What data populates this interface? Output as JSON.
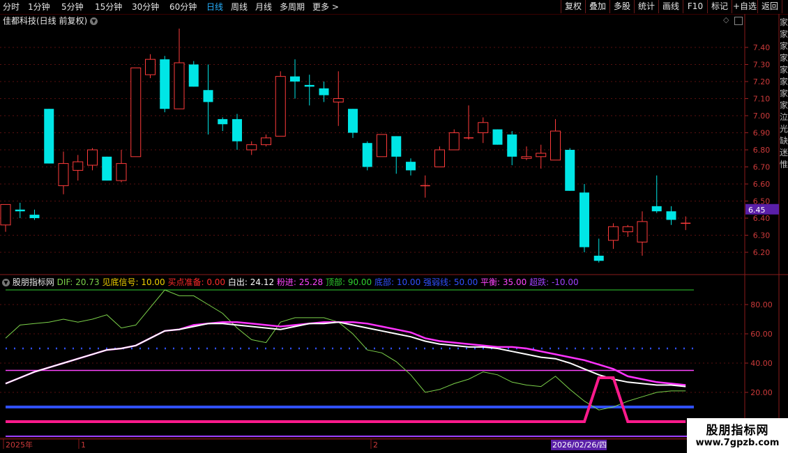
{
  "toolbar": {
    "periods": [
      "分时",
      "1分钟",
      "5分钟",
      "15分钟",
      "30分钟",
      "60分钟",
      "日线",
      "周线",
      "月线",
      "多周期",
      "更多 >"
    ],
    "active_period": "日线",
    "buttons": [
      "复权",
      "叠加",
      "多股",
      "统计",
      "画线",
      "F10",
      "标记",
      "+自选",
      "返回"
    ]
  },
  "main_chart": {
    "title": "佳都科技(日线 前复权)",
    "y_ticks": [
      "7.40",
      "7.30",
      "7.20",
      "7.10",
      "7.00",
      "6.90",
      "6.80",
      "6.70",
      "6.60",
      "6.50",
      "6.40",
      "6.30",
      "6.20"
    ],
    "current_price_label": "6.45",
    "right_strip_text": "家家家家家家家家泣光缺迷惟",
    "candles": [
      {
        "o": 6.36,
        "h": 6.48,
        "l": 6.32,
        "c": 6.48
      },
      {
        "o": 6.45,
        "h": 6.49,
        "l": 6.4,
        "c": 6.44
      },
      {
        "o": 6.42,
        "h": 6.45,
        "l": 6.39,
        "c": 6.4
      },
      {
        "o": 7.04,
        "h": 7.04,
        "l": 6.72,
        "c": 6.72
      },
      {
        "o": 6.59,
        "h": 6.79,
        "l": 6.54,
        "c": 6.72
      },
      {
        "o": 6.68,
        "h": 6.77,
        "l": 6.62,
        "c": 6.73
      },
      {
        "o": 6.71,
        "h": 6.81,
        "l": 6.68,
        "c": 6.8
      },
      {
        "o": 6.76,
        "h": 6.76,
        "l": 6.62,
        "c": 6.62
      },
      {
        "o": 6.62,
        "h": 6.8,
        "l": 6.61,
        "c": 6.72
      },
      {
        "o": 6.76,
        "h": 7.28,
        "l": 6.76,
        "c": 7.28
      },
      {
        "o": 7.24,
        "h": 7.36,
        "l": 7.22,
        "c": 7.33
      },
      {
        "o": 7.33,
        "h": 7.35,
        "l": 7.02,
        "c": 7.04
      },
      {
        "o": 7.04,
        "h": 7.51,
        "l": 7.04,
        "c": 7.31
      },
      {
        "o": 7.3,
        "h": 7.32,
        "l": 7.17,
        "c": 7.17
      },
      {
        "o": 7.15,
        "h": 7.3,
        "l": 6.89,
        "c": 7.08
      },
      {
        "o": 6.98,
        "h": 6.99,
        "l": 6.91,
        "c": 6.95
      },
      {
        "o": 6.98,
        "h": 7.01,
        "l": 6.8,
        "c": 6.85
      },
      {
        "o": 6.8,
        "h": 6.85,
        "l": 6.77,
        "c": 6.83
      },
      {
        "o": 6.83,
        "h": 6.89,
        "l": 6.82,
        "c": 6.87
      },
      {
        "o": 6.88,
        "h": 7.26,
        "l": 6.88,
        "c": 7.23
      },
      {
        "o": 7.23,
        "h": 7.33,
        "l": 7.1,
        "c": 7.2
      },
      {
        "o": 7.18,
        "h": 7.24,
        "l": 7.06,
        "c": 7.17
      },
      {
        "o": 7.16,
        "h": 7.2,
        "l": 7.08,
        "c": 7.12
      },
      {
        "o": 7.08,
        "h": 7.26,
        "l": 6.94,
        "c": 7.1
      },
      {
        "o": 7.04,
        "h": 7.04,
        "l": 6.87,
        "c": 6.9
      },
      {
        "o": 6.84,
        "h": 6.85,
        "l": 6.68,
        "c": 6.7
      },
      {
        "o": 6.76,
        "h": 6.89,
        "l": 6.76,
        "c": 6.89
      },
      {
        "o": 6.88,
        "h": 6.88,
        "l": 6.66,
        "c": 6.76
      },
      {
        "o": 6.73,
        "h": 6.75,
        "l": 6.65,
        "c": 6.68
      },
      {
        "o": 6.59,
        "h": 6.65,
        "l": 6.52,
        "c": 6.59
      },
      {
        "o": 6.7,
        "h": 6.82,
        "l": 6.7,
        "c": 6.8
      },
      {
        "o": 6.8,
        "h": 6.92,
        "l": 6.8,
        "c": 6.9
      },
      {
        "o": 6.87,
        "h": 7.06,
        "l": 6.86,
        "c": 6.87
      },
      {
        "o": 6.9,
        "h": 6.99,
        "l": 6.84,
        "c": 6.96
      },
      {
        "o": 6.92,
        "h": 6.92,
        "l": 6.83,
        "c": 6.83
      },
      {
        "o": 6.89,
        "h": 6.91,
        "l": 6.71,
        "c": 6.76
      },
      {
        "o": 6.75,
        "h": 6.82,
        "l": 6.74,
        "c": 6.76
      },
      {
        "o": 6.76,
        "h": 6.83,
        "l": 6.69,
        "c": 6.78
      },
      {
        "o": 6.74,
        "h": 6.98,
        "l": 6.74,
        "c": 6.91
      },
      {
        "o": 6.8,
        "h": 6.81,
        "l": 6.56,
        "c": 6.56
      },
      {
        "o": 6.55,
        "h": 6.6,
        "l": 6.2,
        "c": 6.23
      },
      {
        "o": 6.18,
        "h": 6.28,
        "l": 6.14,
        "c": 6.15
      },
      {
        "o": 6.27,
        "h": 6.37,
        "l": 6.22,
        "c": 6.35
      },
      {
        "o": 6.32,
        "h": 6.36,
        "l": 6.29,
        "c": 6.35
      },
      {
        "o": 6.26,
        "h": 6.44,
        "l": 6.18,
        "c": 6.38
      },
      {
        "o": 6.47,
        "h": 6.65,
        "l": 6.43,
        "c": 6.44
      },
      {
        "o": 6.44,
        "h": 6.47,
        "l": 6.36,
        "c": 6.39
      },
      {
        "o": 6.37,
        "h": 6.41,
        "l": 6.33,
        "c": 6.37
      }
    ]
  },
  "indicator": {
    "name": "股朋指标网",
    "legend": [
      {
        "label": "DIF: 20.73",
        "color": "#7cd24a"
      },
      {
        "label": "见底信号: 10.00",
        "color": "#f0d000"
      },
      {
        "label": "买点准备: 0.00",
        "color": "#ff2a2a"
      },
      {
        "label": "白出: 24.12",
        "color": "#ffffff"
      },
      {
        "label": "粉进: 25.28",
        "color": "#ff44ff"
      },
      {
        "label": "顶部: 90.00",
        "color": "#2fd12f"
      },
      {
        "label": "底部: 10.00",
        "color": "#3050ff"
      },
      {
        "label": "强弱线: 50.00",
        "color": "#3050ff"
      },
      {
        "label": "平衡: 35.00",
        "color": "#ff44ff"
      },
      {
        "label": "超跌: -10.00",
        "color": "#a040ff"
      }
    ],
    "y_ticks": [
      "80.00",
      "60.00",
      "40.00",
      "20.00"
    ],
    "dif": [
      57,
      66,
      67,
      68,
      70,
      68,
      70,
      73,
      64,
      66,
      78,
      90,
      86,
      86,
      80,
      74,
      64,
      56,
      54,
      68,
      71,
      71,
      71,
      68,
      60,
      49,
      47,
      41,
      32,
      20,
      22,
      26,
      29,
      34,
      32,
      27,
      25,
      24,
      31,
      22,
      14,
      8,
      10,
      14,
      17,
      20,
      21,
      21
    ],
    "white": [
      26,
      30,
      34,
      37,
      40,
      43,
      46,
      49,
      50,
      52,
      57,
      62,
      63,
      65,
      67,
      67,
      66,
      65,
      64,
      63,
      65,
      67,
      67,
      68,
      66,
      64,
      62,
      60,
      58,
      55,
      53,
      52,
      51,
      51,
      50,
      48,
      46,
      44,
      43,
      40,
      36,
      32,
      29,
      27,
      26,
      25,
      25,
      24
    ],
    "pink": [
      26,
      30,
      34,
      37,
      40,
      43,
      46,
      49,
      50,
      52,
      57,
      62,
      63,
      66,
      67,
      68,
      68,
      67,
      66,
      65,
      66,
      67,
      68,
      68,
      68,
      67,
      65,
      63,
      61,
      57,
      55,
      54,
      53,
      52,
      51,
      51,
      50,
      48,
      46,
      44,
      42,
      39,
      36,
      31,
      29,
      27,
      26,
      25
    ],
    "buy_signal": [
      0,
      0,
      0,
      0,
      0,
      0,
      0,
      0,
      0,
      0,
      0,
      0,
      0,
      0,
      0,
      0,
      0,
      0,
      0,
      0,
      0,
      0,
      0,
      0,
      0,
      0,
      0,
      0,
      0,
      0,
      0,
      0,
      0,
      0,
      0,
      0,
      0,
      0,
      0,
      0,
      0,
      30,
      30,
      0,
      0,
      0,
      0,
      0
    ]
  },
  "axis": {
    "labels": [
      "2025年",
      "1",
      "2"
    ],
    "date_label": "2026/02/26/四"
  },
  "colors": {
    "up": "#ff3b3b",
    "down": "#00e6e6",
    "grid": "#5a1010",
    "accent_blue": "#27b1ff"
  },
  "watermark": {
    "line1": "股朋指标网",
    "line2": "www.7gpzb.com"
  }
}
